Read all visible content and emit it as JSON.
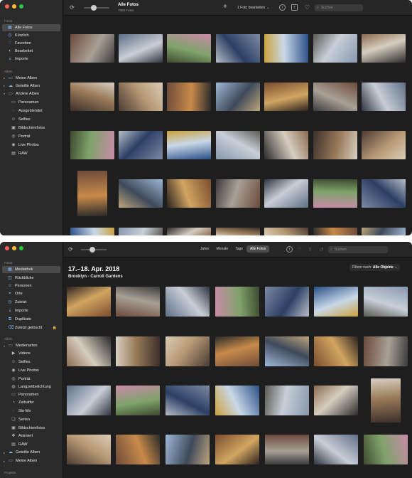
{
  "window1": {
    "title": "Alle Fotos",
    "subtitle": "7886 Fotos",
    "add_button": "+",
    "edit_menu": "1 Foto bearbeiten",
    "search_placeholder": "Suchen",
    "sidebar": {
      "sections": [
        {
          "label": "Fotos"
        },
        {
          "label": "Alben"
        }
      ],
      "items": [
        {
          "label": "Alle Fotos",
          "icon": "photos-icon"
        },
        {
          "label": "Kürzlich",
          "icon": "clock-icon"
        },
        {
          "label": "Favoriten",
          "icon": "heart-icon"
        },
        {
          "label": "Bearbeitet",
          "icon": "edit-icon"
        },
        {
          "label": "Importe",
          "icon": "import-icon"
        },
        {
          "label": "Meine Alben",
          "icon": "folder-icon"
        },
        {
          "label": "Geteilte Alben",
          "icon": "cloud-icon"
        },
        {
          "label": "Andere Alben",
          "icon": "folder-icon"
        },
        {
          "label": "Panoramen",
          "icon": "panorama-icon"
        },
        {
          "label": "Ausgeblendet",
          "icon": "hidden-icon"
        },
        {
          "label": "Selfies",
          "icon": "selfie-icon"
        },
        {
          "label": "Bildschirmfotos",
          "icon": "screenshot-icon"
        },
        {
          "label": "Porträt",
          "icon": "portrait-icon"
        },
        {
          "label": "Live Photos",
          "icon": "live-icon"
        },
        {
          "label": "RAW",
          "icon": "raw-icon"
        }
      ]
    }
  },
  "window2": {
    "segments": [
      "Jahre",
      "Monate",
      "Tage",
      "Alle Fotos"
    ],
    "selected_segment": "Alle Fotos",
    "search_placeholder": "Suchen",
    "date_heading": "17.–18. Apr. 2018",
    "location": "Brooklyn - Carroll Gardens",
    "filter_label": "Filtern nach:",
    "filter_value": "Alle Objekte",
    "sidebar": {
      "sections": [
        {
          "label": "Fotos"
        },
        {
          "label": "Alben"
        },
        {
          "label": "Projekte"
        }
      ],
      "items": [
        {
          "label": "Mediathek",
          "icon": "library-icon"
        },
        {
          "label": "Rückblicke",
          "icon": "memories-icon"
        },
        {
          "label": "Personen",
          "icon": "people-icon"
        },
        {
          "label": "Orte",
          "icon": "places-icon"
        },
        {
          "label": "Zuletzt",
          "icon": "clock-icon"
        },
        {
          "label": "Importe",
          "icon": "import-icon"
        },
        {
          "label": "Duplikate",
          "icon": "duplicate-icon"
        },
        {
          "label": "Zuletzt gelöscht",
          "icon": "trash-icon"
        },
        {
          "label": "Medienarten",
          "icon": "folder-icon"
        },
        {
          "label": "Videos",
          "icon": "video-icon"
        },
        {
          "label": "Selfies",
          "icon": "selfie-icon"
        },
        {
          "label": "Live Photos",
          "icon": "live-icon"
        },
        {
          "label": "Porträt",
          "icon": "portrait-icon"
        },
        {
          "label": "Langzeitbelichtung",
          "icon": "long-exposure-icon"
        },
        {
          "label": "Panoramen",
          "icon": "panorama-icon"
        },
        {
          "label": "Zeitraffer",
          "icon": "timelapse-icon"
        },
        {
          "label": "Slo-Mo",
          "icon": "slomo-icon"
        },
        {
          "label": "Serien",
          "icon": "burst-icon"
        },
        {
          "label": "Bildschirmfotos",
          "icon": "screenshot-icon"
        },
        {
          "label": "Animiert",
          "icon": "animated-icon"
        },
        {
          "label": "RAW",
          "icon": "raw-icon"
        },
        {
          "label": "Geteilte Alben",
          "icon": "cloud-icon"
        },
        {
          "label": "Meine Alben",
          "icon": "folder-icon"
        }
      ]
    }
  },
  "colors": {
    "accent": "#2f6fd6",
    "sidebar_bg": "#2b2b2b",
    "content_bg": "#1e1e1e"
  }
}
